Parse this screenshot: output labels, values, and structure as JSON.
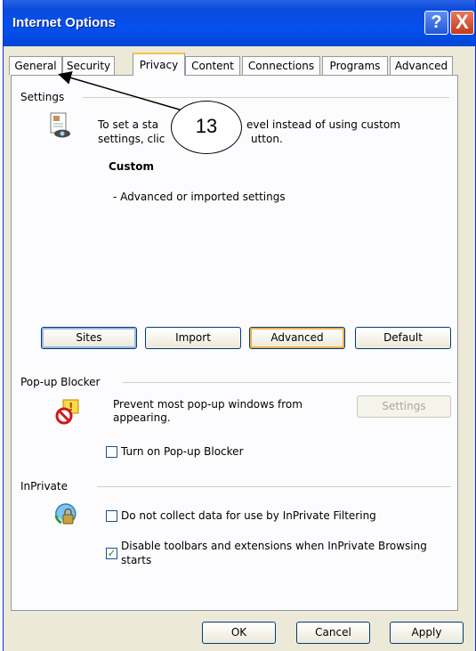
{
  "window": {
    "title": "Internet Options",
    "help_glyph": "?",
    "close_glyph": "X"
  },
  "tabs": [
    {
      "label": "General"
    },
    {
      "label": "Security"
    },
    {
      "label": "Privacy",
      "active": true
    },
    {
      "label": "Content"
    },
    {
      "label": "Connections"
    },
    {
      "label": "Programs"
    },
    {
      "label": "Advanced"
    }
  ],
  "settings": {
    "group_label": "Settings",
    "description_line1": "To set a sta",
    "description_line1_end": "evel instead of using custom",
    "description_line2": "settings, clic",
    "description_line2_end": "utton.",
    "level_name": "Custom",
    "level_detail": "- Advanced or imported settings",
    "buttons": {
      "sites": "Sites",
      "import": "Import",
      "advanced": "Advanced",
      "default": "Default"
    }
  },
  "popup": {
    "group_label": "Pop-up Blocker",
    "description_line1": "Prevent most pop-up windows from",
    "description_line2": "appearing.",
    "settings_button": "Settings",
    "checkbox_label": "Turn on Pop-up Blocker",
    "checkbox_checked": false
  },
  "inprivate": {
    "group_label": "InPrivate",
    "checkbox1_label": "Do not collect data for use by InPrivate Filtering",
    "checkbox1_checked": false,
    "checkbox2_label_line1": "Disable toolbars and extensions when InPrivate Browsing",
    "checkbox2_label_line2": "starts",
    "checkbox2_checked": true
  },
  "footer": {
    "ok": "OK",
    "cancel": "Cancel",
    "apply": "Apply"
  },
  "annotation": {
    "number": "13"
  },
  "colors": {
    "titlebar": "#0550ee",
    "dialog_bg": "#ece9d8",
    "tab_highlight": "#f7c343",
    "check": "#21a121"
  }
}
